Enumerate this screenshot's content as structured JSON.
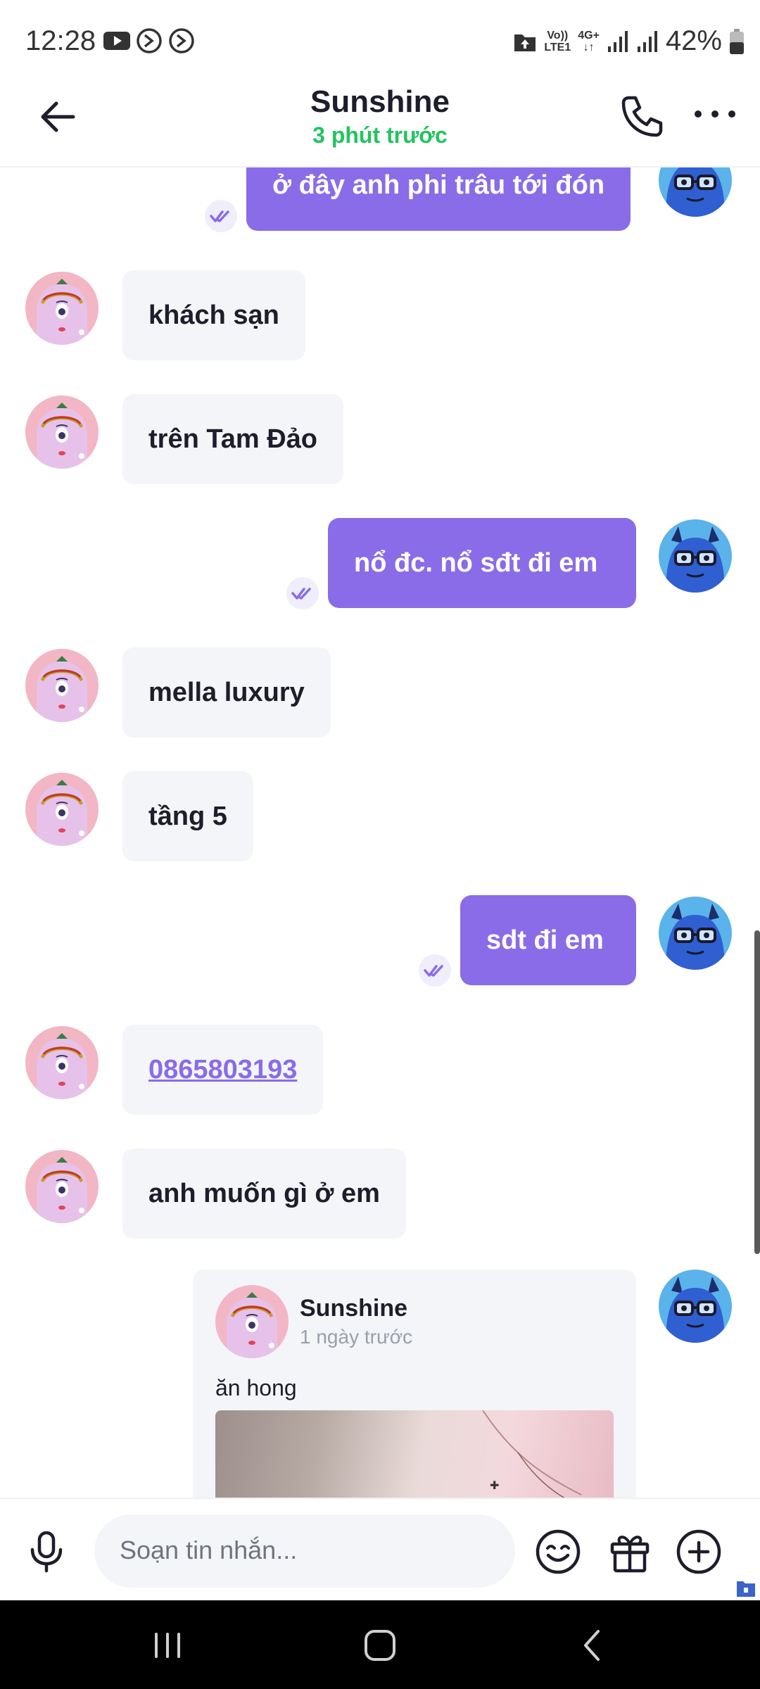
{
  "status_bar": {
    "time": "12:28",
    "network_top": "Vo))",
    "network_bottom": "LTE1",
    "data_top": "4G+",
    "data_bottom": "↓↑",
    "battery": "42%"
  },
  "header": {
    "title": "Sunshine",
    "subtitle": "3 phút trước"
  },
  "messages": [
    {
      "side": "out",
      "text": "ở đây anh phi trâu tới đón"
    },
    {
      "side": "in",
      "text": "khách sạn"
    },
    {
      "side": "in",
      "text": "trên Tam Đảo"
    },
    {
      "side": "out",
      "text": "nổ đc. nổ sđt đi em"
    },
    {
      "side": "in",
      "text": "mella luxury"
    },
    {
      "side": "in",
      "text": "tầng 5"
    },
    {
      "side": "out",
      "text": "sdt đi em"
    },
    {
      "side": "in",
      "text": "0865803193",
      "link": true
    },
    {
      "side": "in",
      "text": "anh muốn gì ở em"
    }
  ],
  "shared_post": {
    "author": "Sunshine",
    "time": "1 ngày trước",
    "text": "ăn hong"
  },
  "composer": {
    "placeholder": "Soạn tin nhắn..."
  },
  "colors": {
    "accent": "#8a6ce8",
    "online": "#22c55e",
    "incoming_bubble": "#f4f5f8"
  },
  "icons": [
    "back-arrow-icon",
    "phone-icon",
    "more-icon",
    "microphone-icon",
    "emoji-icon",
    "gift-icon",
    "plus-icon",
    "recent-apps-icon",
    "home-icon",
    "back-nav-icon"
  ]
}
